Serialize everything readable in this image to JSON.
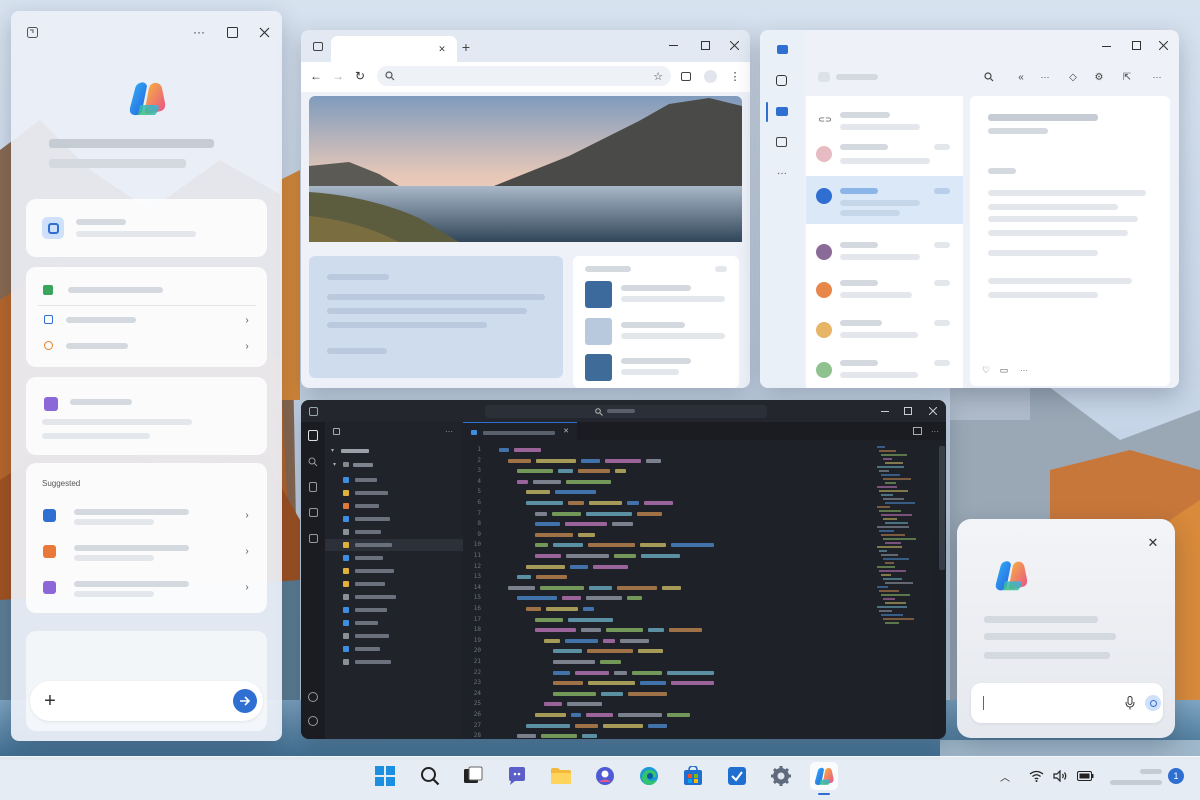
{
  "copilot_panel": {
    "section_label": "Suggested",
    "input_plus": "+",
    "send_icon": "send-arrow-icon"
  },
  "browser": {
    "new_tab": "+",
    "close_tab": "✕"
  },
  "editor": {
    "line_numbers": [
      "1",
      "2",
      "3",
      "4",
      "5",
      "6",
      "7",
      "8",
      "9",
      "10",
      "11",
      "12",
      "13",
      "14",
      "15",
      "16",
      "17",
      "18",
      "19",
      "20",
      "21",
      "22",
      "23",
      "24",
      "25",
      "26",
      "27",
      "28"
    ],
    "tab_close": "✕"
  },
  "copilot_popup": {
    "close": "✕"
  },
  "taskbar": {
    "apps": [
      "start-icon",
      "search-icon",
      "task-view-icon",
      "teams-icon",
      "file-explorer-icon",
      "photos-icon",
      "edge-icon",
      "store-icon",
      "todo-icon",
      "settings-icon",
      "copilot-icon"
    ],
    "notification_count": "1"
  },
  "colors": {
    "accent": "#2f6fd1",
    "editor_bg": "#1e2128",
    "selected_mail": "#dbe8f8"
  }
}
